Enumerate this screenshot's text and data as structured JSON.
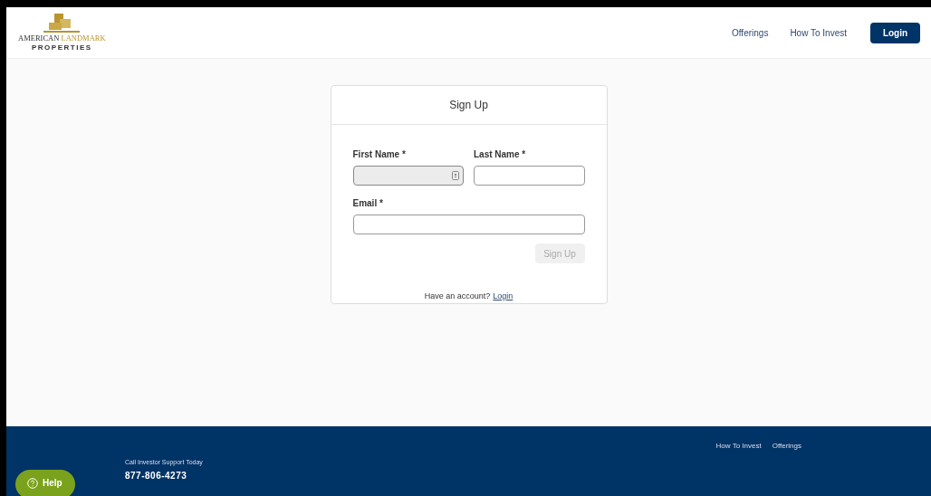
{
  "header": {
    "logo": {
      "name_part_1": "AMERICAN",
      "name_part_2": "LANDMARK",
      "tagline": "PROPERTIES"
    },
    "nav": [
      {
        "label": "Offerings"
      },
      {
        "label": "How To Invest"
      }
    ],
    "login_button": "Login"
  },
  "signup_card": {
    "title": "Sign Up",
    "fields": [
      {
        "label": "First Name *",
        "disabled": true,
        "autofill_icon": true
      },
      {
        "label": "Last Name *",
        "disabled": false,
        "autofill_icon": false
      },
      {
        "label": "Email *",
        "disabled": false,
        "autofill_icon": false
      }
    ],
    "submit": {
      "label": "Sign Up",
      "disabled": true
    },
    "footer_text": "Have an account?",
    "footer_link": "Login"
  },
  "footer": {
    "support_label": "Call Investor Support Today",
    "phone": "877-806-4273",
    "links": [
      {
        "label": "How To Invest"
      },
      {
        "label": "Offerings"
      }
    ]
  },
  "help_button": "Help"
}
